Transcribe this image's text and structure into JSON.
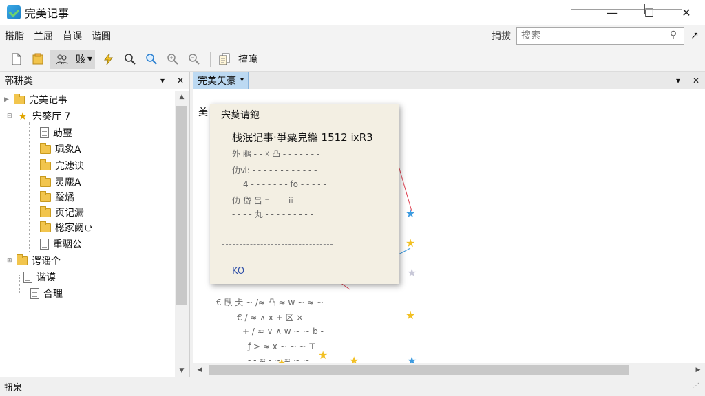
{
  "window": {
    "title": "完美记事",
    "controls": {
      "minimize": "—",
      "maximize": "☐",
      "close": "✕"
    }
  },
  "menu": {
    "items": [
      "搭脂",
      "兰屈",
      "苜误",
      "谐圓"
    ]
  },
  "search": {
    "label": "捐拔",
    "placeholder": "搜索",
    "pin": "↗"
  },
  "toolbar": {
    "view_label": "赅",
    "view_arrow": "▾",
    "text_label": "擅晻"
  },
  "sidebar": {
    "title": "鄣耕类",
    "dropdown": "▾",
    "close": "✕",
    "tree": [
      {
        "label": "完美记事"
      },
      {
        "label": "宍葵厅 7"
      },
      {
        "label": "莇璽"
      },
      {
        "label": "珮象A"
      },
      {
        "label": "完漶谀"
      },
      {
        "label": "灵麃A"
      },
      {
        "label": "瑿燏"
      },
      {
        "label": "页记漏"
      },
      {
        "label": "棇家阙℮"
      },
      {
        "label": "重骃公"
      },
      {
        "label": "谔谣个"
      },
      {
        "label": "谐谟"
      },
      {
        "label": "合理"
      }
    ]
  },
  "main": {
    "tab": "完美矢豪",
    "tab_arrow": "▾",
    "tab_dropdown": "▾",
    "tab_close": "✕",
    "canvas_label": "美",
    "note": {
      "title": "宍葵请鉋",
      "heading": "栈泯记事·爭粟皃繲 1512 ⅸR3",
      "line1": "外 鹇 - - ☓ 凸 - - - - - - -",
      "line2": "仂ⅵ: - - - - - - - - - - - -",
      "line3": "4 - - - - - - - fo - - - - -",
      "line4": "仂 岱 吕 ⁻ - - - ⅲ - - - - - - - -",
      "line5": "- - - - 丸 - - - - - - - - -",
      "footer": "KO"
    },
    "scribbles": {
      "row1": "€ 臥 仧 ~ /≈ 凸 ≈ w ~ ≈ ~",
      "row2": "€ / ≈ ∧ ⅹ  + 区 ×  -",
      "row3": "+ / ≈ ∨ ∧ w  ~ ~  b -",
      "row4": "ƒ > ≈  ⅹ ~  ~ ~  ⊤",
      "row5": "- -  ≈ - ~  ≈ ~  ~"
    }
  },
  "status": {
    "text": "扭泉"
  },
  "colors": {
    "tab_active": "#bcd9f2",
    "star_yellow": "#f2c023",
    "star_blue": "#3d9be0",
    "star_grey": "#c8c8d8",
    "folder": "#f2c54d"
  }
}
